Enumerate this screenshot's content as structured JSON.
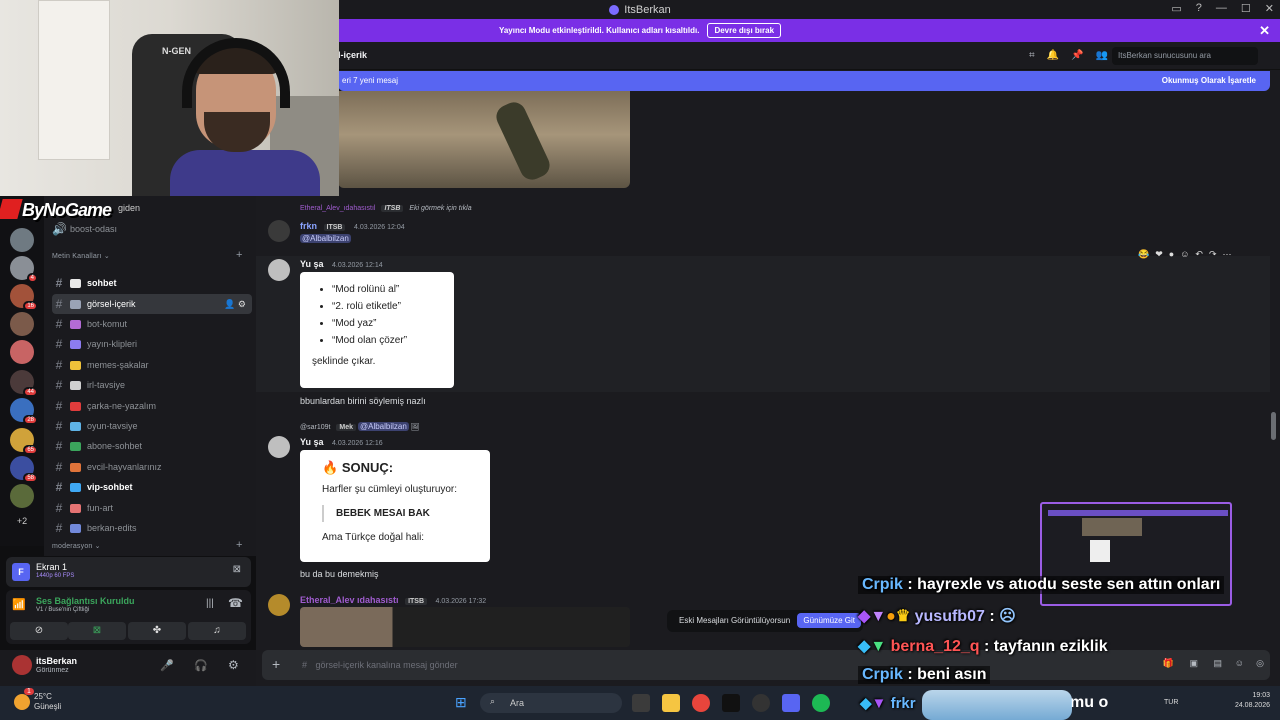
{
  "window": {
    "title": "ItsBerkan",
    "controls": [
      "▭",
      "?",
      "—",
      "☐",
      "✕"
    ]
  },
  "banner": {
    "text": "Yayıncı Modu etkinleştirildi. Kullanıcı adları kısaltıldı.",
    "button": "Devre dışı bırak"
  },
  "channel_header": {
    "title": "l-içerik",
    "search_placeholder": "ItsBerkan sunucusunu ara"
  },
  "new_messages": {
    "left": "eri 7 yeni mesaj",
    "right": "Okunmuş Olarak İşaretle"
  },
  "guild_badges": [
    "4",
    "16",
    "44",
    "28",
    "65",
    "58"
  ],
  "guild_more": "+2",
  "brand": {
    "name": "ByNoGame",
    "partial_channel": "giden"
  },
  "sidebar": {
    "partial_channel": "boost-odası",
    "category_text": "Metin Kanalları",
    "category_mod": "moderasyon",
    "channels": [
      {
        "name": "sohbet",
        "color": "#e8e8e8"
      },
      {
        "name": "görsel-içerik",
        "color": "#9aa3b5"
      },
      {
        "name": "bot-komut",
        "color": "#b36bd6"
      },
      {
        "name": "yayın-klipleri",
        "color": "#8c7cf0"
      },
      {
        "name": "memes-şakalar",
        "color": "#f0c23a"
      },
      {
        "name": "irl-tavsiye",
        "color": "#d0d0d0"
      },
      {
        "name": "çarka-ne-yazalım",
        "color": "#e03c3c"
      },
      {
        "name": "oyun-tavsiye",
        "color": "#5fb3e6"
      },
      {
        "name": "abone-sohbet",
        "color": "#3ba55c"
      },
      {
        "name": "evcil-hayvanlarınız",
        "color": "#e0743a"
      },
      {
        "name": "vip-sohbet",
        "color": "#3fa9f5"
      },
      {
        "name": "fun-art",
        "color": "#e57373"
      },
      {
        "name": "berkan-edits",
        "color": "#7289da"
      }
    ]
  },
  "screen_share": {
    "title": "Ekran 1",
    "sub": "1440p 60 FPS"
  },
  "voice": {
    "status": "Ses Bağlantısı Kuruldu",
    "channel": "V1 / Buse'nin Çiftliği"
  },
  "user": {
    "name": "itsBerkan",
    "status": "Görünmez"
  },
  "messages": {
    "m1": {
      "reply_user": "Etheral_Alev_ıdahasıstıl",
      "reply_tag": "ITSB",
      "reply_text": "Eki görmek için tıkla",
      "author": "frkn",
      "author_tag": "ITSB",
      "time": "4.03.2026 12:04",
      "mention": "@Albalbilzan"
    },
    "m2": {
      "author": "Yu şa",
      "time": "4.03.2026 12:14",
      "bullets": [
        "“Mod rolünü al”",
        "“2. rolü etiketle”",
        "“Mod yaz”",
        "“Mod olan çözer”"
      ],
      "card_footer": "şeklinde çıkar.",
      "text": "bbunlardan birini söylemiş nazlı"
    },
    "m3": {
      "reply_user": "@sar109t",
      "reply_tag": "Mek",
      "reply_mention": "@Albalbilzan",
      "author": "Yu şa",
      "time": "4.03.2026 12:16",
      "card_title": "SONUÇ:",
      "card_line1": "Harfler şu cümleyi oluşturuyor:",
      "card_quote": "BEBEK MESAI BAK",
      "card_line2": "Ama Türkçe doğal hali:",
      "text": "bu da bu demekmiş"
    },
    "m4": {
      "author": "Etheral_Alev ıdahasıstı",
      "author_tag": "ITSB",
      "time": "4.03.2026 17:32"
    }
  },
  "old_messages": {
    "text": "Eski Mesajları Görüntülüyorsun",
    "button": "Günümüze Git"
  },
  "composer": {
    "placeholder": "görsel-içerik kanalına mesaj gönder"
  },
  "overlay_chat": [
    {
      "user": "Crpik",
      "text": ": hayrexle vs atıodu seste sen attın onları"
    },
    {
      "user": "yusufb07",
      "text": ":"
    },
    {
      "user": "berna_12_q",
      "text": ": tayfanın eziklik"
    },
    {
      "user": "Crpik",
      "text": ": beni asın"
    },
    {
      "user": "frkr",
      "text": "mu o"
    }
  ],
  "taskbar": {
    "weather_temp": "25°C",
    "weather_desc": "Güneşli",
    "weather_badge": "1",
    "search": "Ara",
    "lang": "TUR",
    "time": "19:03",
    "date": "24.08.2026"
  },
  "colors": {
    "banner": "#7a2fe6",
    "accent": "#5865f2",
    "bg": "#1b1b1f"
  }
}
